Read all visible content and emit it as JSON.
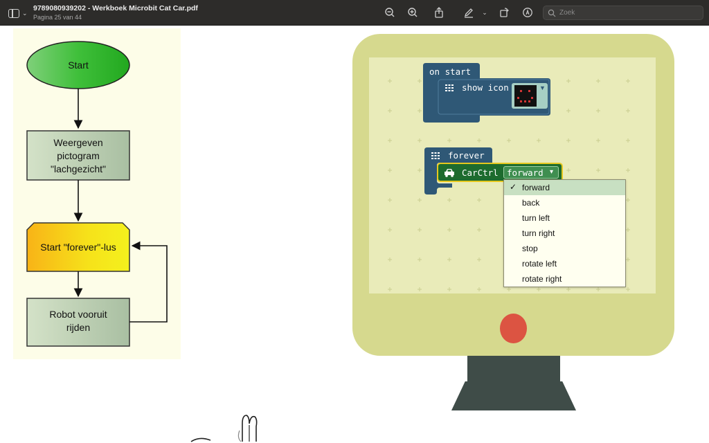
{
  "toolbar": {
    "title": "9789080939202 -  Werkboek Microbit Cat Car.pdf",
    "subtitle": "Pagina 25 van 44",
    "search_placeholder": "Zoek"
  },
  "flowchart": {
    "start": "Start",
    "step1": [
      "Weergeven",
      "pictogram",
      "\"lachgezicht\""
    ],
    "loop": "Start \"forever\"-lus",
    "step2": [
      "Robot vooruit",
      "rijden"
    ]
  },
  "blocks": {
    "on_start": "on start",
    "show_icon": "show icon",
    "forever": "forever",
    "carctrl": "CarCtrl",
    "selected": "forward",
    "dropdown_arrow": "▾"
  },
  "dropdown": {
    "check": "✓",
    "options": [
      "forward",
      "back",
      "turn left",
      "turn right",
      "stop",
      "rotate left",
      "rotate right"
    ]
  },
  "colors": {
    "monitor_body": "#d6d98e",
    "screen": "#e9ebb9",
    "block_blue": "#2f5876",
    "car_green": "#1d6b2e",
    "power_button": "#dc5442",
    "stand": "#3f4c48"
  }
}
